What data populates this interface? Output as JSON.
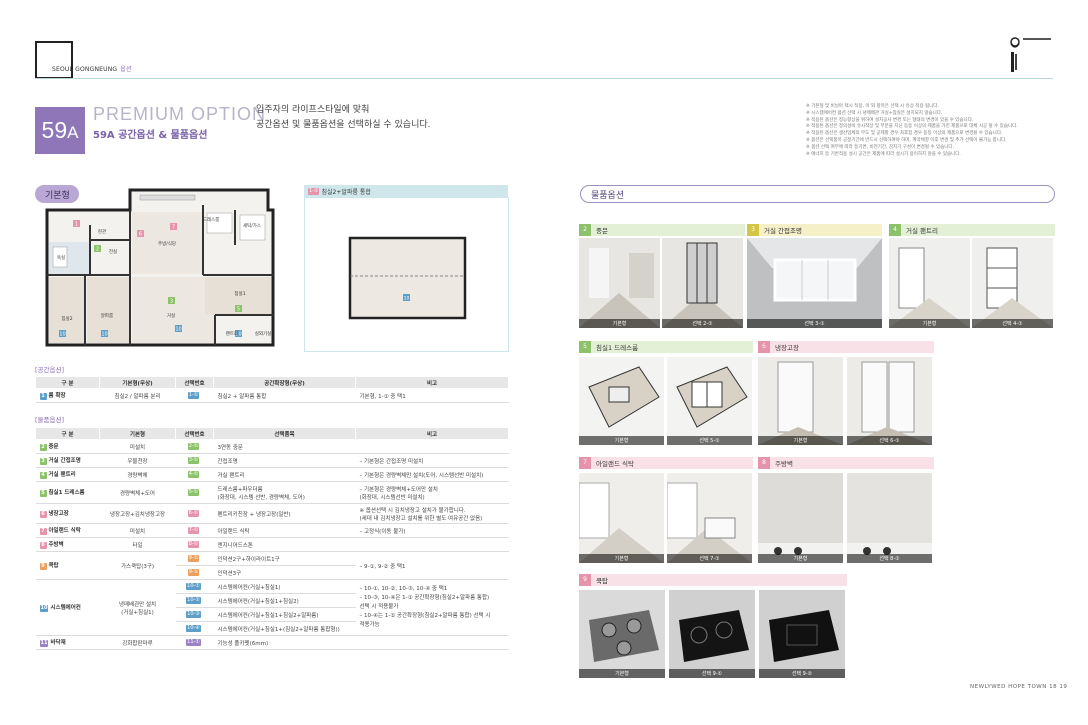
{
  "header": {
    "section": "SEOUL GONGNEUNG",
    "section_suffix": "옵션"
  },
  "title": {
    "badge_num": "59",
    "badge_letter": "A",
    "premium": "PREMIUM OPTION",
    "subtitle": "59A 공간옵션 & 물품옵션",
    "desc_line1": "입주자의 라이프스타일에 맞춰",
    "desc_line2": "공간옵션 및 물품옵션을 선택하실 수 있습니다."
  },
  "notes": [
    "※ 기본형 및 비닐아 택시 적용, 이 외 항목은 선택 시 유상 적용 됩니다.",
    "※ 시스템에어컨 옵션 선택 시 냉매배관 거실+침실은 설치되지 않습니다.",
    "※ 적용된 옵션은 정능향상을 위하여 설치공사 변경 또는 형태의 변경이 있을 수 있습니다.",
    "※ 적용된 옵션은 정의설비 유사적상 및 부분을 지닌 동등 이상의 제품을 가진 제품으로 대체 시공 될 수 있습니다.",
    "※ 적용된 옵션은 생산업체의 부도 및 공제할 경우 차후함 경우 동등 이상의 제품으로 변경될 수 있습니다.",
    "※ 옵션은 선택품목 공정기간에 반드시 선택하여야 하며, 계약체결 이후 변경 및 추가 선택이 불가능 합니다.",
    "※ 옵션 선택 여부에 따라 등기면, 비전기간, 감지기 구성이 변경될 수 있습니다.",
    "※ 에너지 등 기반적용 설시 공간은 제품에 따라 설시가 용이하지 않을 수 있습니다."
  ],
  "basic_label": "기본형",
  "product_label": "물품옵션",
  "opt1": {
    "num": "1-①",
    "label": "침실2+알파룸 통합"
  },
  "plan_rooms": [
    "드레스룸",
    "주방/식당",
    "현관",
    "전실",
    "침실2",
    "침실1",
    "거실",
    "욕실",
    "알파룸",
    "팬트리",
    "세탁/가스",
    "침실3",
    "실외기실"
  ],
  "space_table": {
    "label": "[공간옵션]",
    "headers": [
      "구 분",
      "기본형(무상)",
      "선택번호",
      "공간확장형(무상)",
      "비고"
    ],
    "rows": [
      {
        "num": "1",
        "name": "룸 확장",
        "base": "침실2 / 알파룸 분리",
        "sel": "1-①",
        "option": "침실2 + 알파룸 통합",
        "note": "기본형, 1-① 중 택1"
      }
    ]
  },
  "product_table": {
    "label": "[물품옵션]",
    "headers": [
      "구 분",
      "기본형",
      "선택번호",
      "선택품목",
      "비고"
    ],
    "rows": [
      {
        "num": "2",
        "name": "중문",
        "base": "미설치",
        "sel": "2-①",
        "item": "3연동 중문",
        "note": "",
        "color": "green"
      },
      {
        "num": "3",
        "name": "거실 간접조명",
        "base": "우물천장",
        "sel": "3-①",
        "item": "간접조명",
        "note": "– 기본형은 간접조명 미설치",
        "color": "green"
      },
      {
        "num": "4",
        "name": "거실 팬트리",
        "base": "경량벽체",
        "sel": "4-①",
        "item": "거실 팬트리",
        "note": "– 기본형은 경량벽체만 설치(도어, 시스템선반 미설치)",
        "color": "green"
      },
      {
        "num": "5",
        "name": "침실1 드레스룸",
        "base": "경량벽체+도어",
        "sel": "5-①",
        "item": "드레스룸+파우더룸",
        "item2": "(화장대, 시스템 선반, 경량벽체, 도어)",
        "note": "– 기본형은 경량벽체+도어만 설치",
        "note2": "(화장대, 시스템선반 미설치)",
        "color": "green"
      },
      {
        "num": "6",
        "name": "냉장고장",
        "base": "냉장고장+김치냉장고장",
        "sel": "6-①",
        "item": "펜트리키친장 + 냉장고장(일반)",
        "note": "※ 옵션선택 시 김치냉장고 설치가 불가합니다.",
        "note2": "(세대 내 김치냉장고 설치를 위한 별도 여유공간 없음)",
        "color": "pink"
      },
      {
        "num": "7",
        "name": "아일랜드 식탁",
        "base": "미설치",
        "sel": "7-①",
        "item": "아일랜드 식탁",
        "note": "– 고정식(이동 불가)",
        "color": "pink"
      },
      {
        "num": "8",
        "name": "주방벽",
        "base": "타일",
        "sel": "8-①",
        "item": "엔지니어드스톤",
        "note": "",
        "color": "pink"
      },
      {
        "num": "9",
        "name": "쿡탑",
        "base": "가스쿡탑(3구)",
        "sel": "9-①",
        "item": "인덕션2구+하이라이트1구",
        "note": "– 9-①, 9-② 중 택1",
        "color": "orange",
        "sel2": "9-②",
        "item_b": "인덕션3구"
      },
      {
        "num": "10",
        "name": "시스템에어컨",
        "base": "냉매배관만 설치",
        "base2": "(거실+침실1)",
        "color": "blue",
        "subs": [
          {
            "sel": "10-①",
            "item": "시스템에어컨(거실+침실1)"
          },
          {
            "sel": "10-②",
            "item": "시스템에어컨(거실+침실1+침실2)"
          },
          {
            "sel": "10-③",
            "item": "시스템에어컨(거실+침실1+침실2+알파룸)"
          },
          {
            "sel": "10-④",
            "item": "시스템에어컨(거실+침실1+(침실2+알파룸 통합형))"
          }
        ],
        "notes": [
          "– 10-①, 10-②, 10-③, 10-④ 중 택1",
          "– 10-③, 10-④은 1-① 공간확장형(침실2+알파룸 통합)",
          "선택 시 적용불가",
          "– 10-④는 1-① 공간확장형(침실2+알파룸 통합) 선택 시",
          "적용가능"
        ]
      },
      {
        "num": "11",
        "name": "바닥재",
        "base": "강화합판마루",
        "sel": "11-①",
        "item": "기능성 폴카펫(6mm)",
        "note": "",
        "color": "purple"
      }
    ]
  },
  "photos": {
    "sec2": {
      "num": "2",
      "label": "중문",
      "left": "기본형",
      "right": "선택 2-①"
    },
    "sec3": {
      "num": "3",
      "label": "거실 간접조명",
      "right": "선택 3-①"
    },
    "sec4": {
      "num": "4",
      "label": "거실 팬트리",
      "left": "기본형",
      "right": "선택 4-①"
    },
    "sec5": {
      "num": "5",
      "label": "침실1 드레스룸",
      "left": "기본형",
      "right": "선택 5-①"
    },
    "sec6": {
      "num": "6",
      "label": "냉장고장",
      "left": "기본형",
      "right": "선택 6-①"
    },
    "sec7": {
      "num": "7",
      "label": "아일랜드 식탁",
      "left": "기본형",
      "right": "선택 7-①"
    },
    "sec8": {
      "num": "8",
      "label": "주방벽",
      "left": "기본형",
      "right": "선택 8-①"
    },
    "sec9": {
      "num": "9",
      "label": "쿡탑",
      "left": "기본형",
      "mid": "선택 9-①",
      "right": "선택 9-②"
    }
  },
  "footer": "NEWLYWED HOPE TOWN   18 19",
  "colors": {
    "accent": "#8e76b8",
    "green": "#8cc26a",
    "pink": "#e694ac",
    "blue": "#5d9fc9"
  }
}
